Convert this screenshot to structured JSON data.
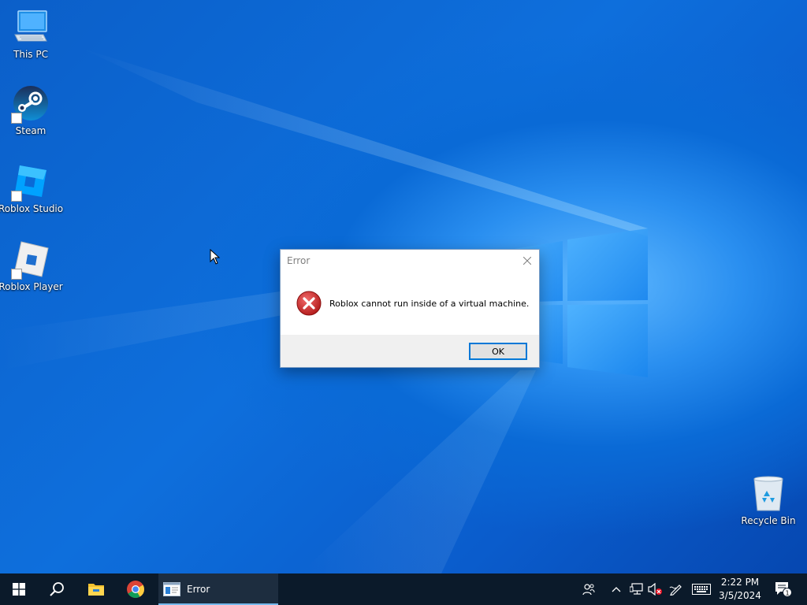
{
  "desktop": {
    "icons": [
      {
        "label": "This PC",
        "icon": "computer-icon"
      },
      {
        "label": "Steam",
        "icon": "steam-icon"
      },
      {
        "label": "Roblox Studio",
        "icon": "roblox-studio-icon"
      },
      {
        "label": "Roblox Player",
        "icon": "roblox-player-icon"
      },
      {
        "label": "Recycle Bin",
        "icon": "recycle-bin-icon"
      }
    ],
    "accent_color": "#0a6ad6"
  },
  "dialog": {
    "title": "Error",
    "message": "Roblox cannot run inside of a virtual machine.",
    "ok_label": "OK",
    "icon": "error-icon"
  },
  "taskbar": {
    "start_icon": "windows-start-icon",
    "search_icon": "search-icon",
    "pinned": [
      {
        "icon": "file-explorer-icon"
      },
      {
        "icon": "chrome-icon"
      }
    ],
    "active_app": {
      "label": "Error",
      "icon": "window-app-icon"
    },
    "tray_icons": [
      "people-icon",
      "chevron-up-icon",
      "network-icon",
      "volume-muted-icon",
      "pen-icon",
      "keyboard-icon"
    ],
    "clock": {
      "time": "2:22 PM",
      "date": "3/5/2024"
    },
    "notifications": {
      "count": "1"
    }
  }
}
